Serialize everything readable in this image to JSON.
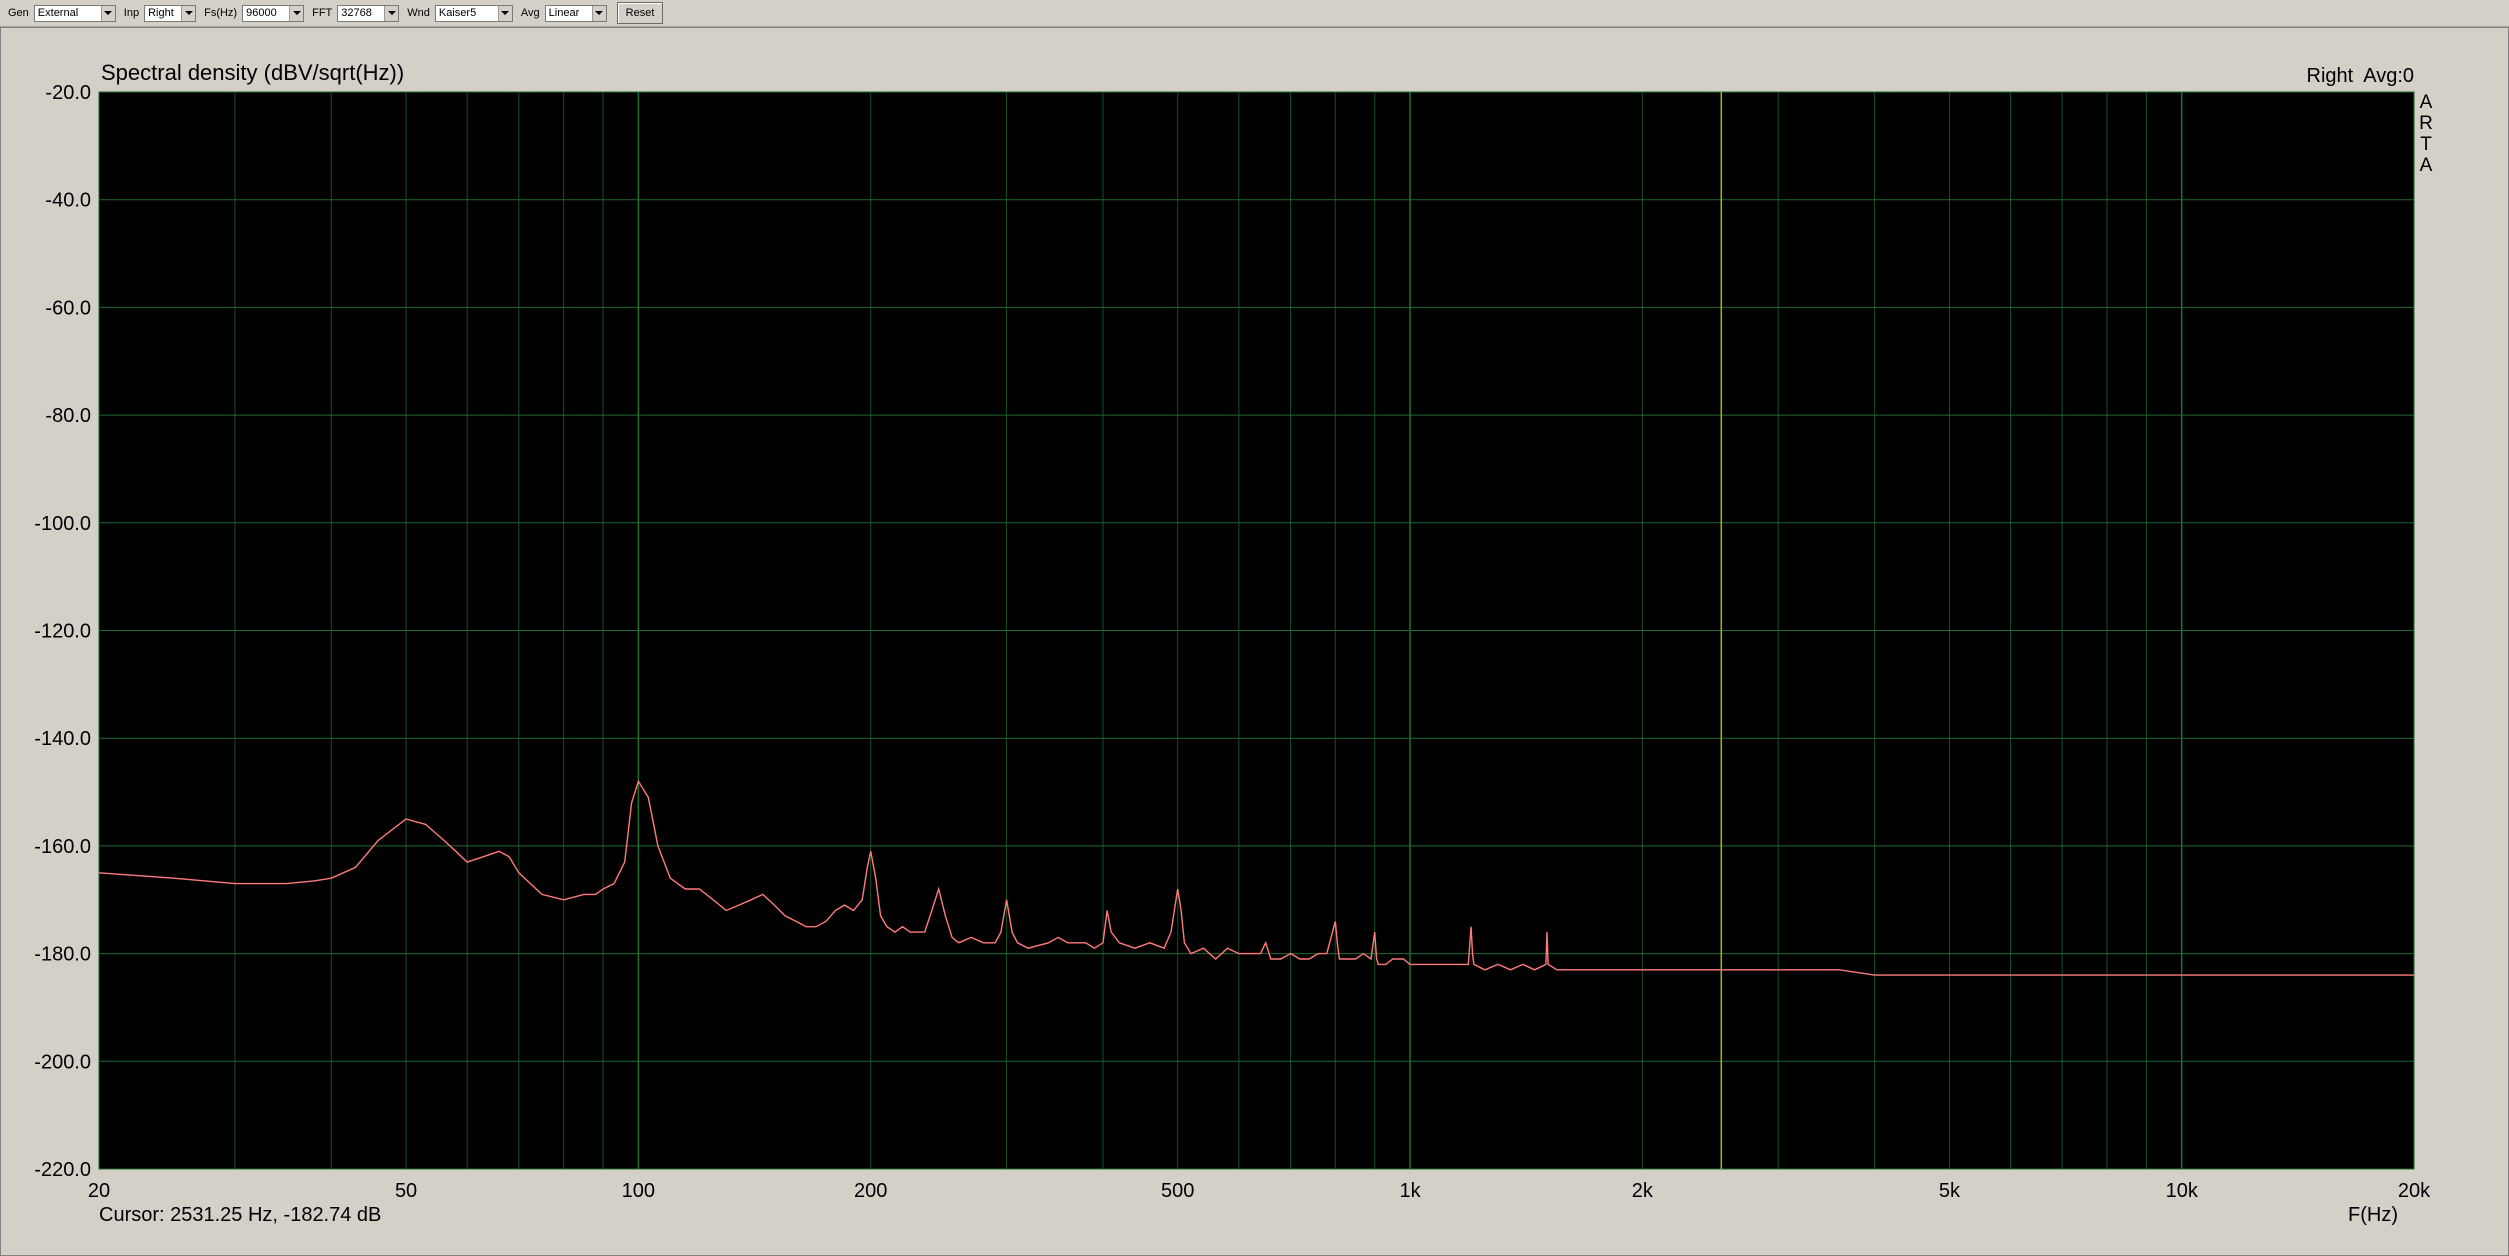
{
  "toolbar": {
    "gen": {
      "label": "Gen",
      "value": "External"
    },
    "inp": {
      "label": "Inp",
      "value": "Right"
    },
    "fs": {
      "label": "Fs(Hz)",
      "value": "96000"
    },
    "fft": {
      "label": "FFT",
      "value": "32768"
    },
    "wnd": {
      "label": "Wnd",
      "value": "Kaiser5"
    },
    "avg": {
      "label": "Avg",
      "value": "Linear"
    },
    "reset_label": "Reset"
  },
  "chart_data": {
    "type": "line",
    "title": "Spectral density (dBV/sqrt(Hz))",
    "status": "Right  Avg:0",
    "side_label": [
      "A",
      "R",
      "T",
      "A"
    ],
    "xlabel": "F(Hz)",
    "cursor_text": "Cursor: 2531.25 Hz, -182.74 dB",
    "cursor_x": 2531.25,
    "x_scale": "log",
    "xlim": [
      20,
      20000
    ],
    "ylim": [
      -220,
      -20
    ],
    "y_ticks": [
      -20,
      -40,
      -60,
      -80,
      -100,
      -120,
      -140,
      -160,
      -180,
      -200,
      -220
    ],
    "y_tick_labels": [
      "-20.0",
      "-40.0",
      "-60.0",
      "-80.0",
      "-100.0",
      "-120.0",
      "-140.0",
      "-160.0",
      "-180.0",
      "-200.0",
      "-220.0"
    ],
    "x_ticks": [
      20,
      50,
      100,
      200,
      500,
      1000,
      2000,
      5000,
      10000,
      20000
    ],
    "x_tick_labels": [
      "20",
      "50",
      "100",
      "200",
      "500",
      "1k",
      "2k",
      "5k",
      "10k",
      "20k"
    ],
    "grid": true,
    "colors": {
      "background": "#000000",
      "grid": "#1f6b2f",
      "trace": "#ff7b7b",
      "cursor": "#b8b000"
    },
    "series": [
      {
        "x": [
          20,
          25,
          30,
          35,
          38,
          40,
          43,
          46,
          50,
          53,
          56,
          58,
          60,
          63,
          66,
          68,
          70,
          75,
          80,
          85,
          88,
          90,
          93,
          96,
          98,
          100,
          103,
          106,
          110,
          115,
          120,
          125,
          130,
          135,
          140,
          145,
          150,
          155,
          160,
          165,
          170,
          175,
          180,
          185,
          190,
          195,
          198,
          200,
          203,
          206,
          210,
          215,
          220,
          225,
          230,
          235,
          240,
          245,
          250,
          255,
          260,
          270,
          280,
          290,
          295,
          300,
          305,
          310,
          320,
          340,
          350,
          360,
          380,
          390,
          400,
          405,
          410,
          420,
          440,
          460,
          480,
          490,
          500,
          505,
          510,
          520,
          540,
          560,
          580,
          600,
          620,
          640,
          650,
          660,
          680,
          700,
          720,
          740,
          760,
          780,
          800,
          805,
          810,
          830,
          850,
          870,
          890,
          900,
          905,
          910,
          930,
          950,
          980,
          1000,
          1020,
          1050,
          1080,
          1100,
          1130,
          1160,
          1190,
          1200,
          1205,
          1210,
          1250,
          1300,
          1350,
          1400,
          1450,
          1500,
          1505,
          1510,
          1550,
          1600,
          1700,
          1800,
          1900,
          2000,
          2200,
          2400,
          2600,
          2800,
          3000,
          3200,
          3400,
          3600,
          4000,
          4500,
          5000,
          6000,
          7000,
          8000,
          10000,
          12000,
          14000,
          16000,
          18000,
          20000
        ],
        "y": [
          -165,
          -166,
          -167,
          -167,
          -166.5,
          -166,
          -164,
          -159,
          -155,
          -156,
          -159,
          -161,
          -163,
          -162,
          -161,
          -162,
          -165,
          -169,
          -170,
          -169,
          -169,
          -168,
          -167,
          -163,
          -152,
          -148,
          -151,
          -160,
          -166,
          -168,
          -168,
          -170,
          -172,
          -171,
          -170,
          -169,
          -171,
          -173,
          -174,
          -175,
          -175,
          -174,
          -172,
          -171,
          -172,
          -170,
          -164,
          -161,
          -166,
          -173,
          -175,
          -176,
          -175,
          -176,
          -176,
          -176,
          -172,
          -168,
          -173,
          -177,
          -178,
          -177,
          -178,
          -178,
          -176,
          -170,
          -176,
          -178,
          -179,
          -178,
          -177,
          -178,
          -178,
          -179,
          -178,
          -172,
          -176,
          -178,
          -179,
          -178,
          -179,
          -176,
          -168,
          -172,
          -178,
          -180,
          -179,
          -181,
          -179,
          -180,
          -180,
          -180,
          -178,
          -181,
          -181,
          -180,
          -181,
          -181,
          -180,
          -180,
          -174,
          -178,
          -181,
          -181,
          -181,
          -180,
          -181,
          -176,
          -181,
          -182,
          -182,
          -181,
          -181,
          -182,
          -182,
          -182,
          -182,
          -182,
          -182,
          -182,
          -182,
          -175,
          -180,
          -182,
          -183,
          -182,
          -183,
          -182,
          -183,
          -182,
          -176,
          -182,
          -183,
          -183,
          -183,
          -183,
          -183,
          -183,
          -183,
          -183,
          -183,
          -183,
          -183,
          -183,
          -183,
          -183,
          -184,
          -184,
          -184,
          -184,
          -184,
          -184,
          -184,
          -184,
          -184,
          -184,
          -184,
          -184
        ]
      }
    ]
  }
}
